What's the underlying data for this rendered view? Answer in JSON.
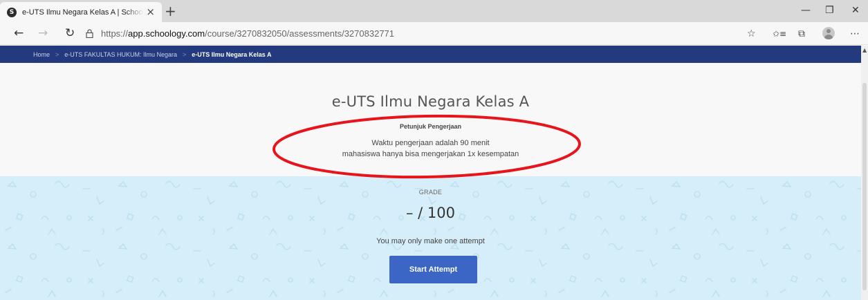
{
  "browser": {
    "tab_title": "e-UTS Ilmu Negara Kelas A | Schoology",
    "favicon_letter": "S",
    "new_tab_symbol": "+",
    "url_prefix": "https://",
    "url_host": "app.schoology.com",
    "url_path": "/course/3270832050/assessments/3270832771",
    "icons": {
      "back": "←",
      "forward": "→",
      "refresh": "↻",
      "lock": "🔒",
      "close_tab": "×",
      "favorite": "☆",
      "favorites_list": "✩≡",
      "collections": "⧉",
      "menu": "⋯",
      "minimize": "—",
      "restore": "❐",
      "close_window": "✕"
    }
  },
  "breadcrumb": {
    "items": [
      "Home",
      "e-UTS FAKULTAS HUKUM: Ilmu Negara"
    ],
    "separator": ">",
    "current": "e-UTS Ilmu Negara Kelas A"
  },
  "assessment": {
    "title": "e-UTS Ilmu Negara Kelas A",
    "instructions_heading": "Petunjuk Pengerjaan",
    "instructions": [
      "Waktu pengerjaan adalah 90 menit",
      "mahasiswa hanya bisa mengerjakan 1x kesempatan"
    ]
  },
  "grade": {
    "label": "GRADE",
    "score": "– / 100",
    "attempt_note": "You may only make one attempt",
    "start_button": "Start Attempt"
  },
  "colors": {
    "nav_blue": "#233a7e",
    "button_blue": "#3b66c5",
    "grade_bg": "#d6eef9",
    "annotation_red": "#e8141b"
  }
}
